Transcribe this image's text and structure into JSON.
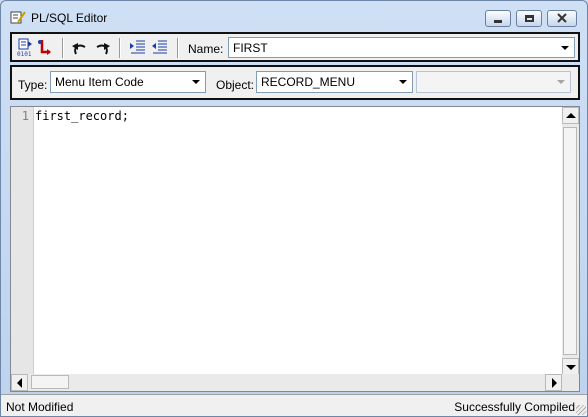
{
  "window": {
    "title": "PL/SQL Editor"
  },
  "toolbar": {
    "name_label": "Name:",
    "name_value": "FIRST",
    "buttons": [
      "compile-icon",
      "go-to-error-icon",
      "undo-icon",
      "redo-icon",
      "indent-icon",
      "outdent-icon"
    ]
  },
  "selectors": {
    "type_label": "Type:",
    "type_value": "Menu Item Code",
    "object_label": "Object:",
    "object_value": "RECORD_MENU",
    "third_value": ""
  },
  "editor": {
    "lines": [
      {
        "number": "1",
        "code": "first_record;"
      }
    ]
  },
  "status": {
    "left": "Not Modified",
    "right": "Successfully Compiled"
  },
  "colors": {
    "window_frame": "#bcd2ee",
    "toolbar_bg": "#f0f0f0",
    "editor_bg": "#ffffff",
    "gutter_bg": "#e6e6e6",
    "line_number": "#808080"
  }
}
